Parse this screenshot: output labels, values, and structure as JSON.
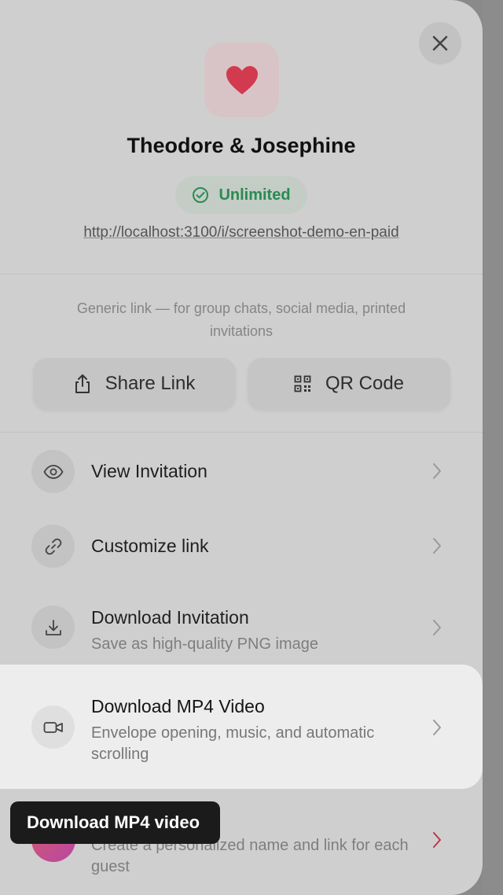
{
  "header": {
    "close_icon": "close-icon",
    "app_icon": "heart-icon",
    "title": "Theodore & Josephine",
    "badge_label": "Unlimited",
    "url": "http://localhost:3100/i/screenshot-demo-en-paid"
  },
  "share": {
    "description": "Generic link — for group chats, social media, printed invitations",
    "share_label": "Share Link",
    "qr_label": "QR Code"
  },
  "actions": [
    {
      "title": "View Invitation",
      "icon": "eye-icon"
    },
    {
      "title": "Customize link",
      "icon": "link-icon"
    },
    {
      "title": "Download Invitation",
      "subtitle": "Save as high-quality PNG image",
      "icon": "download-icon"
    },
    {
      "title": "Download MP4 Video",
      "subtitle": "Envelope opening, music, and automatic scrolling",
      "icon": "video-icon"
    },
    {
      "subtitle": "Create a personalized name and link for each guest",
      "icon": "guest-avatar"
    }
  ],
  "tooltip": {
    "text": "Download MP4 video"
  },
  "colors": {
    "accent_red": "#d23a4f",
    "badge_green": "#2b8a51",
    "overlay": "#cfcfcf"
  }
}
